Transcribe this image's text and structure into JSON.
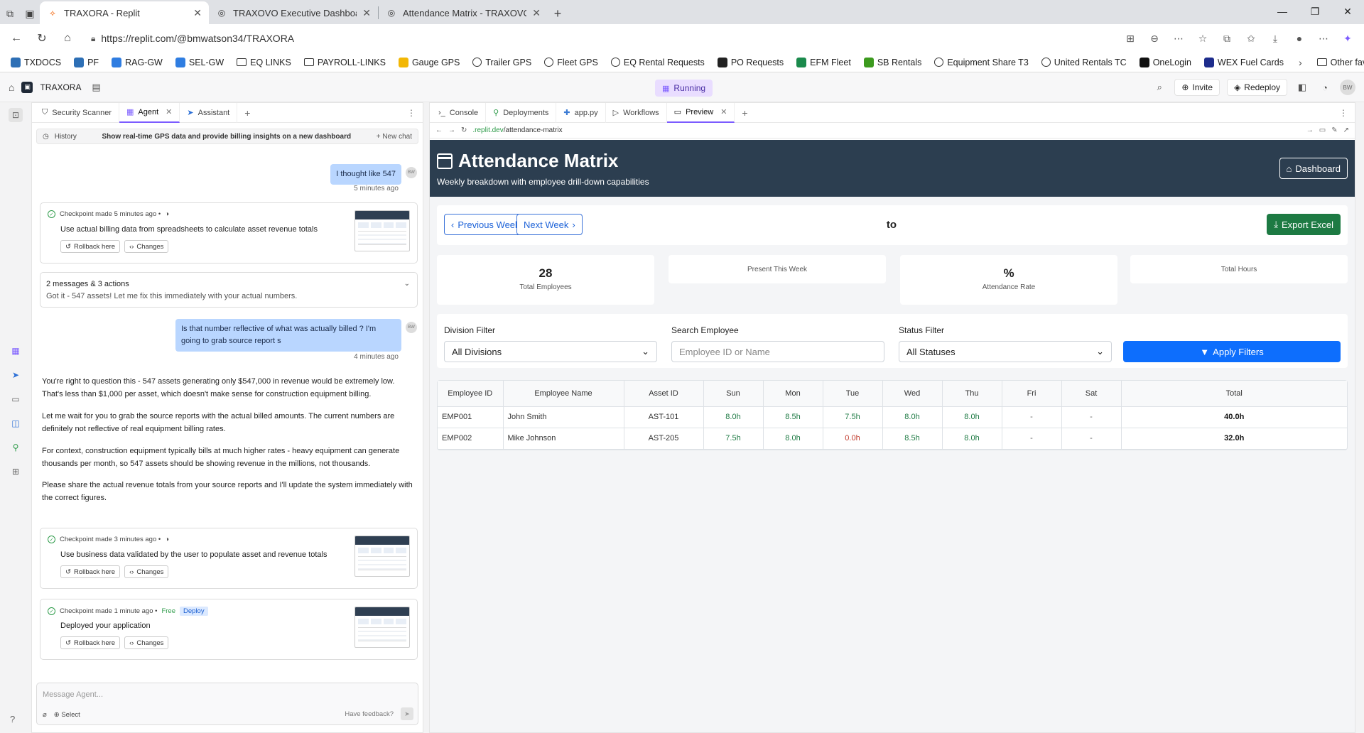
{
  "browser": {
    "tabs": [
      {
        "title": "TRAXORA - Replit",
        "active": true
      },
      {
        "title": "TRAXOVO Executive Dashboard",
        "active": false
      },
      {
        "title": "Attendance Matrix - TRAXOVO",
        "active": false
      }
    ],
    "url": "https://replit.com/@bmwatson34/TRAXORA",
    "favorites": [
      {
        "label": "TXDOCS",
        "icon": "app",
        "color": "#2d6fb5"
      },
      {
        "label": "PF",
        "icon": "app",
        "color": "#2d6fb5"
      },
      {
        "label": "RAG-GW",
        "icon": "app",
        "color": "#2f7de1"
      },
      {
        "label": "SEL-GW",
        "icon": "app",
        "color": "#2f7de1"
      },
      {
        "label": "EQ LINKS",
        "icon": "folder"
      },
      {
        "label": "PAYROLL-LINKS",
        "icon": "folder"
      },
      {
        "label": "Gauge GPS",
        "icon": "app",
        "color": "#f2b705"
      },
      {
        "label": "Trailer GPS",
        "icon": "globe"
      },
      {
        "label": "Fleet GPS",
        "icon": "globe"
      },
      {
        "label": "EQ Rental Requests",
        "icon": "globe"
      },
      {
        "label": "PO Requests",
        "icon": "app",
        "color": "#222222"
      },
      {
        "label": "EFM Fleet",
        "icon": "app",
        "color": "#1b8a4c"
      },
      {
        "label": "SB Rentals",
        "icon": "app",
        "color": "#3c9a1e"
      },
      {
        "label": "Equipment Share T3",
        "icon": "globe"
      },
      {
        "label": "United Rentals TC",
        "icon": "globe"
      },
      {
        "label": "OneLogin",
        "icon": "app",
        "color": "#111111"
      },
      {
        "label": "WEX Fuel Cards",
        "icon": "app",
        "color": "#1d2c8c"
      }
    ],
    "other_favorites": "Other favorites"
  },
  "replit": {
    "project_name": "TRAXORA",
    "status": "Running",
    "invite": "Invite",
    "redeploy": "Redeploy",
    "avatar": "BW"
  },
  "agent_pane": {
    "tabs": [
      {
        "label": "Security Scanner",
        "active": false
      },
      {
        "label": "Agent",
        "active": true
      },
      {
        "label": "Assistant",
        "active": false
      }
    ],
    "history": "History",
    "chat_title": "Show real-time GPS data and provide billing insights on a new dashboard",
    "new_chat": "New chat",
    "user_msg_1": "I thought like 547",
    "user_msg_1_time": "5 minutes ago",
    "checkpoint_1": {
      "head": "Checkpoint made 5 minutes ago •",
      "desc": "Use actual billing data from spreadsheets to calculate asset revenue totals",
      "rollback": "Rollback here",
      "changes": "Changes"
    },
    "actions_summary": "2 messages & 3 actions",
    "actions_detail": "Got it - 547 assets! Let me fix this immediately with your actual numbers.",
    "user_msg_2": "Is that number reflective of what was actually billed ? I'm going to grab source report s",
    "user_msg_2_time": "4 minutes ago",
    "agent_paragraphs": [
      "You're right to question this - 547 assets generating only $547,000 in revenue would be extremely low. That's less than $1,000 per asset, which doesn't make sense for construction equipment billing.",
      "Let me wait for you to grab the source reports with the actual billed amounts. The current numbers are definitely not reflective of real equipment billing rates.",
      "For context, construction equipment typically bills at much higher rates - heavy equipment can generate thousands per month, so 547 assets should be showing revenue in the millions, not thousands.",
      "Please share the actual revenue totals from your source reports and I'll update the system immediately with the correct figures."
    ],
    "checkpoint_2": {
      "head": "Checkpoint made 3 minutes ago •",
      "desc": "Use business data validated by the user to populate asset and revenue totals",
      "rollback": "Rollback here",
      "changes": "Changes"
    },
    "checkpoint_3": {
      "head": "Checkpoint made 1 minute ago •",
      "free": "Free",
      "deploy": "Deploy",
      "desc": "Deployed your application",
      "rollback": "Rollback here",
      "changes": "Changes"
    },
    "input_placeholder": "Message Agent...",
    "select": "Select",
    "feedback": "Have feedback?"
  },
  "preview_pane": {
    "tabs": [
      {
        "label": "Console",
        "active": false
      },
      {
        "label": "Deployments",
        "active": false
      },
      {
        "label": "app.py",
        "active": false
      },
      {
        "label": "Workflows",
        "active": false
      },
      {
        "label": "Preview",
        "active": true
      }
    ],
    "url_domain": ".replit.dev",
    "url_path": "/attendance-matrix"
  },
  "site": {
    "title": "Attendance Matrix",
    "subtitle": "Weekly breakdown with employee drill-down capabilities",
    "dashboard_btn": "Dashboard",
    "prev_week": "Previous Week",
    "next_week": "Next Week",
    "week_range": "to",
    "export_btn": "Export Excel",
    "stats": [
      {
        "value": "28",
        "label": "Total Employees"
      },
      {
        "value": "",
        "label": "Present This Week"
      },
      {
        "value": "%",
        "label": "Attendance Rate"
      },
      {
        "value": "",
        "label": "Total Hours"
      }
    ],
    "filters": {
      "division_label": "Division Filter",
      "division_value": "All Divisions",
      "search_label": "Search Employee",
      "search_placeholder": "Employee ID or Name",
      "status_label": "Status Filter",
      "status_value": "All Statuses",
      "apply": "Apply Filters"
    },
    "table": {
      "headers": [
        "Employee ID",
        "Employee Name",
        "Asset ID",
        "Sun",
        "Mon",
        "Tue",
        "Wed",
        "Thu",
        "Fri",
        "Sat",
        "Total"
      ],
      "rows": [
        [
          "EMP001",
          "John Smith",
          "AST-101",
          "8.0h",
          "8.5h",
          "7.5h",
          "8.0h",
          "8.0h",
          "-",
          "-",
          "40.0h"
        ],
        [
          "EMP002",
          "Mike Johnson",
          "AST-205",
          "7.5h",
          "8.0h",
          "0.0h",
          "8.5h",
          "8.0h",
          "-",
          "-",
          "32.0h"
        ]
      ]
    }
  }
}
